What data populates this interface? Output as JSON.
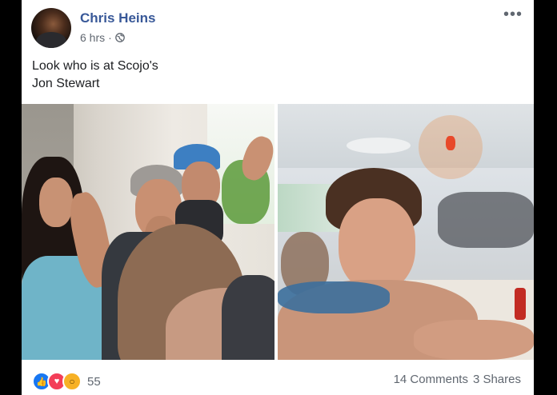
{
  "post": {
    "author": "Chris Heins",
    "time": "6 hrs",
    "separator": "·",
    "text_line1": "Look who is at Scojo's",
    "text_line2": "Jon Stewart",
    "more_label": "•••"
  },
  "reactions": {
    "icons": [
      "like-icon",
      "love-icon",
      "wow-icon"
    ],
    "count": "55"
  },
  "footer": {
    "comments": "14 Comments",
    "shares": "3 Shares"
  },
  "colors": {
    "author": "#385898",
    "muted": "#606770",
    "like": "#1877f2",
    "love": "#f33e58",
    "wow": "#f7b125"
  }
}
